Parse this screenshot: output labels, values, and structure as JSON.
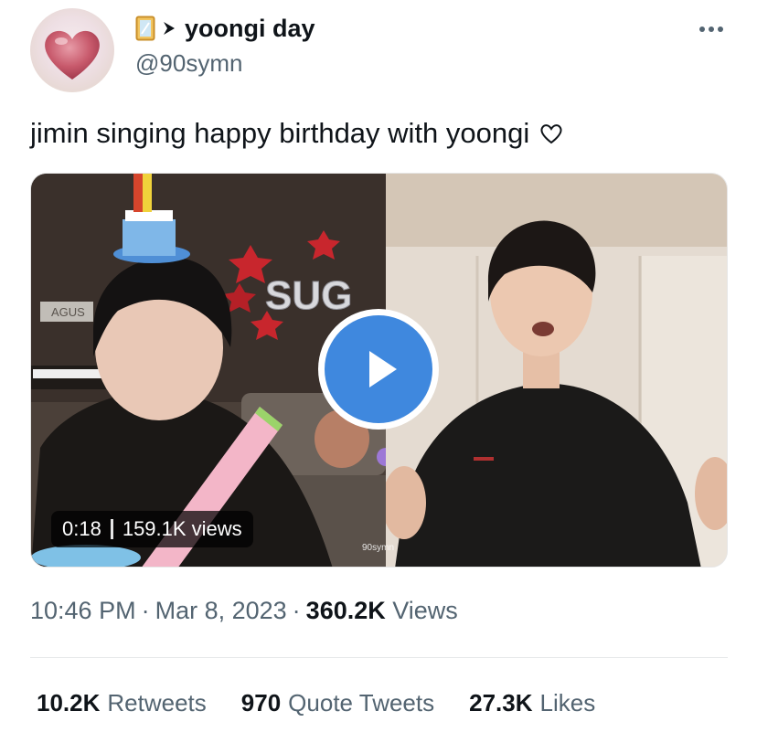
{
  "author": {
    "display_name": "yoongi day",
    "handle": "@90symn",
    "name_icons": [
      "mirror-emoji-icon",
      "arrow-right-icon"
    ]
  },
  "tweet": {
    "text": "jimin singing happy birthday with yoongi"
  },
  "media": {
    "duration": "0:18",
    "views": "159.1K views",
    "left_panel_text": "SUG",
    "left_wall_text": "AGUS",
    "watermark": "90symn"
  },
  "meta": {
    "time": "10:46 PM",
    "separator": "·",
    "date": "Mar 8, 2023",
    "views_count": "360.2K",
    "views_label": "Views"
  },
  "stats": {
    "retweets_count": "10.2K",
    "retweets_label": "Retweets",
    "quotes_count": "970",
    "quotes_label": "Quote Tweets",
    "likes_count": "27.3K",
    "likes_label": "Likes"
  },
  "colors": {
    "primary_text": "#0f1419",
    "secondary_text": "#536471",
    "play_button": "#3f88de",
    "divider": "#e7e9ea"
  }
}
